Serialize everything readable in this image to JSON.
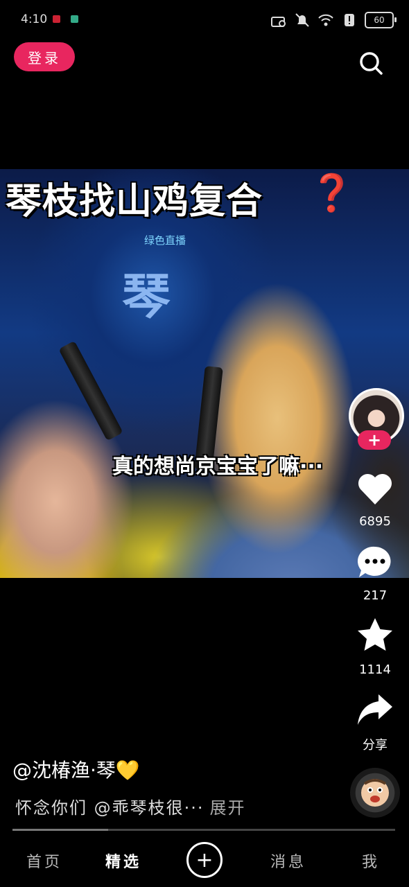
{
  "status_bar": {
    "time": "4:10",
    "battery": "60"
  },
  "top_bar": {
    "login_label": "登录",
    "search_icon": "search-icon"
  },
  "video": {
    "title": "琴枝找山鸡复合",
    "title_mark": "❓",
    "stage_label": "绿色直播",
    "backdrop_char": "琴",
    "caption": "真的想尚京宝宝了嘛···"
  },
  "rail": {
    "likes": "6895",
    "comments": "217",
    "favorites": "1114",
    "share_label": "分享"
  },
  "post": {
    "author": "@沈椿渔·琴💛",
    "description": "怀念你们 @乖琴枝很···",
    "expand_label": "展开",
    "progress": 0.25
  },
  "nav": {
    "home": "首页",
    "featured": "精选",
    "messages": "消息",
    "me": "我"
  },
  "colors": {
    "accent": "#e8265f",
    "background": "#000000"
  }
}
